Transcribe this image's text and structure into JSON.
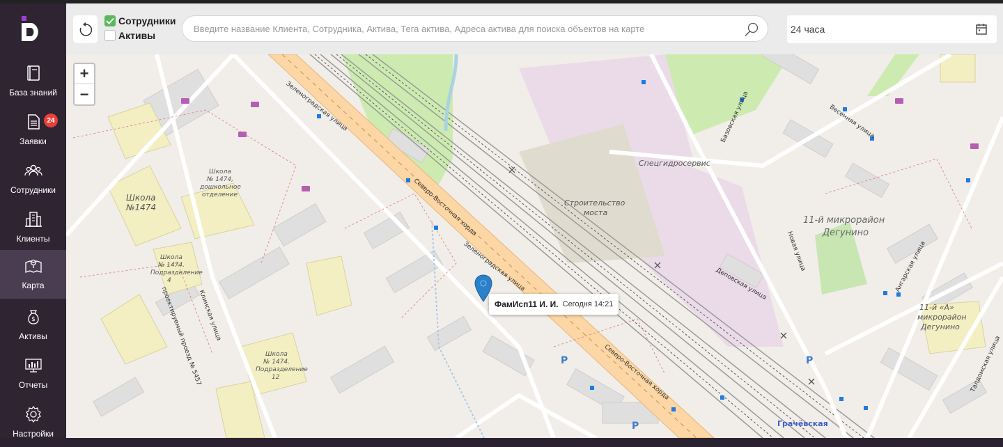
{
  "sidebar": {
    "items": [
      {
        "label": "База знаний",
        "icon": "book-icon"
      },
      {
        "label": "Заявки",
        "icon": "document-icon",
        "badge": "24"
      },
      {
        "label": "Сотрудники",
        "icon": "users-icon"
      },
      {
        "label": "Клиенты",
        "icon": "buildings-icon"
      },
      {
        "label": "Карта",
        "icon": "map-icon",
        "active": true
      },
      {
        "label": "Активы",
        "icon": "money-bag-icon"
      },
      {
        "label": "Отчеты",
        "icon": "monitor-chart-icon"
      },
      {
        "label": "Настройки",
        "icon": "gear-icon"
      }
    ]
  },
  "filters": {
    "employees": {
      "label": "Сотрудники",
      "checked": true
    },
    "assets": {
      "label": "Активы",
      "checked": false
    }
  },
  "search": {
    "placeholder": "Введите название Клиента, Сотрудника, Актива, Тега актива, Адреса актива для поиска объектов на карте",
    "value": ""
  },
  "period": {
    "value": "24 часа"
  },
  "map": {
    "zoom_in": "+",
    "zoom_out": "−",
    "marker": {
      "name": "ФамИсп11 И. И.",
      "time": "Сегодня 14:21"
    },
    "labels": {
      "district1": "11-й микрорайон",
      "district1b": "Дегунино",
      "district2": "11-й «А»",
      "district2b": "микрорайон",
      "district2c": "Дегунино",
      "construction": "Строительство",
      "construction2": "моста",
      "spec": "Спецгидросервис",
      "school1": "Школа",
      "school1b": "№1474",
      "school2a": "Школа",
      "school2b": "№ 1474,",
      "school2c": "дошкольное",
      "school2d": "отделение",
      "school3a": "Школа",
      "school3b": "№ 1474.",
      "school3c": "Подразделение",
      "school3d": "4",
      "school4a": "Школа",
      "school4b": "№ 1474.",
      "school4c": "Подразделение",
      "school4d": "12",
      "street1": "Северо-Восточная хорда",
      "street2": "Зеленоградская улица",
      "street3": "Северо-Восточная хорда",
      "street4": "Деповская улица",
      "street5": "Базовская улица",
      "street6": "Весенняя улица",
      "street7": "Новая улица",
      "street8": "Ангарская улица",
      "street9": "Талдомская улица",
      "street10": "Клинская улица",
      "street11": "проектируемый проезд № 5457",
      "street12": "Зеленоградская улица",
      "station": "Грачёвская"
    }
  }
}
